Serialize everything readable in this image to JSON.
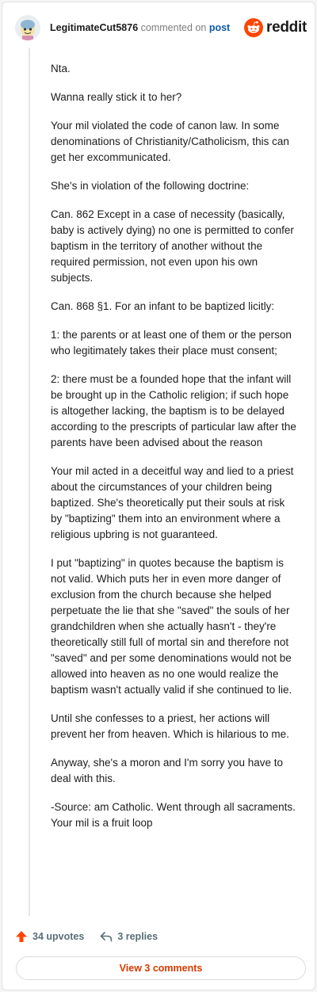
{
  "header": {
    "username": "LegitimateCut5876",
    "action_text": "commented on",
    "post_link": "post",
    "brand": "reddit"
  },
  "comment": {
    "paragraphs": [
      "Nta.",
      "Wanna really stick it to her?",
      "Your mil violated the code of canon law. In some denominations of Christianity/Catholicism, this can get her excommunicated.",
      "She's in violation of the following doctrine:",
      "Can. 862 Except in a case of necessity (basically, baby is actively dying) no one is permitted to confer baptism in the territory of another without the required permission, not even upon his own subjects.",
      "Can. 868 §1. For an infant to be baptized licitly:",
      "1: the parents or at least one of them or the person who legitimately takes their place must consent;",
      "2: there must be a founded hope that the infant will be brought up in the Catholic religion; if such hope is altogether lacking, the baptism is to be delayed according to the prescripts of particular law after the parents have been advised about the reason",
      "Your mil acted in a deceitful way and lied to a priest about the circumstances of your children being baptized. She's theoretically put their souls at risk by \"baptizing\" them into an environment where a religious upbring is not guaranteed.",
      "I put \"baptizing\" in quotes because the baptism is not valid. Which puts her in even more danger of exclusion from the church because she helped perpetuate the lie that she \"saved\" the souls of her grandchildren when she actually hasn't - they're theoretically still full of mortal sin and therefore not \"saved\" and per some denominations would not be allowed into heaven as no one would realize the baptism wasn't actually valid if she continued to lie.",
      "Until she confesses to a priest, her actions will prevent her from heaven. Which is hilarious to me.",
      "Anyway, she's a moron and I'm sorry you have to deal with this.",
      "-Source: am Catholic. Went through all sacraments. Your mil is a fruit loop"
    ]
  },
  "footer": {
    "upvotes": "34 upvotes",
    "replies": "3 replies",
    "view_button": "View 3 comments"
  },
  "colors": {
    "brand_orange": "#ff4500",
    "upvote_orange": "#ff4500",
    "link_blue": "#0f5aa8",
    "view_button_text": "#d93a00"
  },
  "icons": {
    "avatar": "snoo-avatar-icon",
    "brand": "reddit-logo-icon",
    "upvote": "upvote-arrow-icon",
    "reply": "reply-arrow-icon"
  }
}
